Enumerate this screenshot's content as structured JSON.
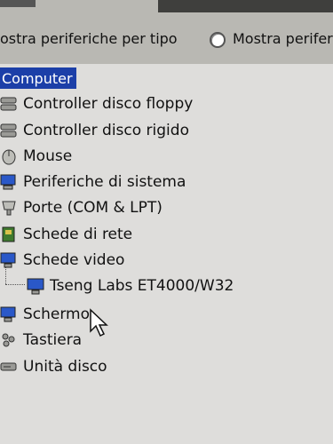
{
  "options": {
    "by_type": {
      "label": "ostra periferiche per tipo",
      "selected": true
    },
    "by_connection": {
      "label": "Mostra periferic",
      "selected": false
    }
  },
  "tree": {
    "root": "Computer",
    "items": [
      {
        "label": "Controller disco floppy",
        "icon": "floppy-controller-icon"
      },
      {
        "label": "Controller disco rigido",
        "icon": "hard-disk-controller-icon"
      },
      {
        "label": "Mouse",
        "icon": "mouse-icon"
      },
      {
        "label": "Periferiche di sistema",
        "icon": "system-devices-icon"
      },
      {
        "label": "Porte (COM & LPT)",
        "icon": "ports-icon"
      },
      {
        "label": "Schede di rete",
        "icon": "network-card-icon"
      },
      {
        "label": "Schede video",
        "icon": "display-adapter-icon"
      },
      {
        "label": "Tseng Labs ET4000/W32",
        "icon": "monitor-icon",
        "child": true
      },
      {
        "label": "Schermo",
        "icon": "monitor-icon"
      },
      {
        "label": "Tastiera",
        "icon": "keyboard-icon"
      },
      {
        "label": "Unità disco",
        "icon": "disk-drive-icon"
      }
    ]
  },
  "colors": {
    "selection": "#1c3fa8",
    "monitor_screen": "#2a58c8"
  }
}
